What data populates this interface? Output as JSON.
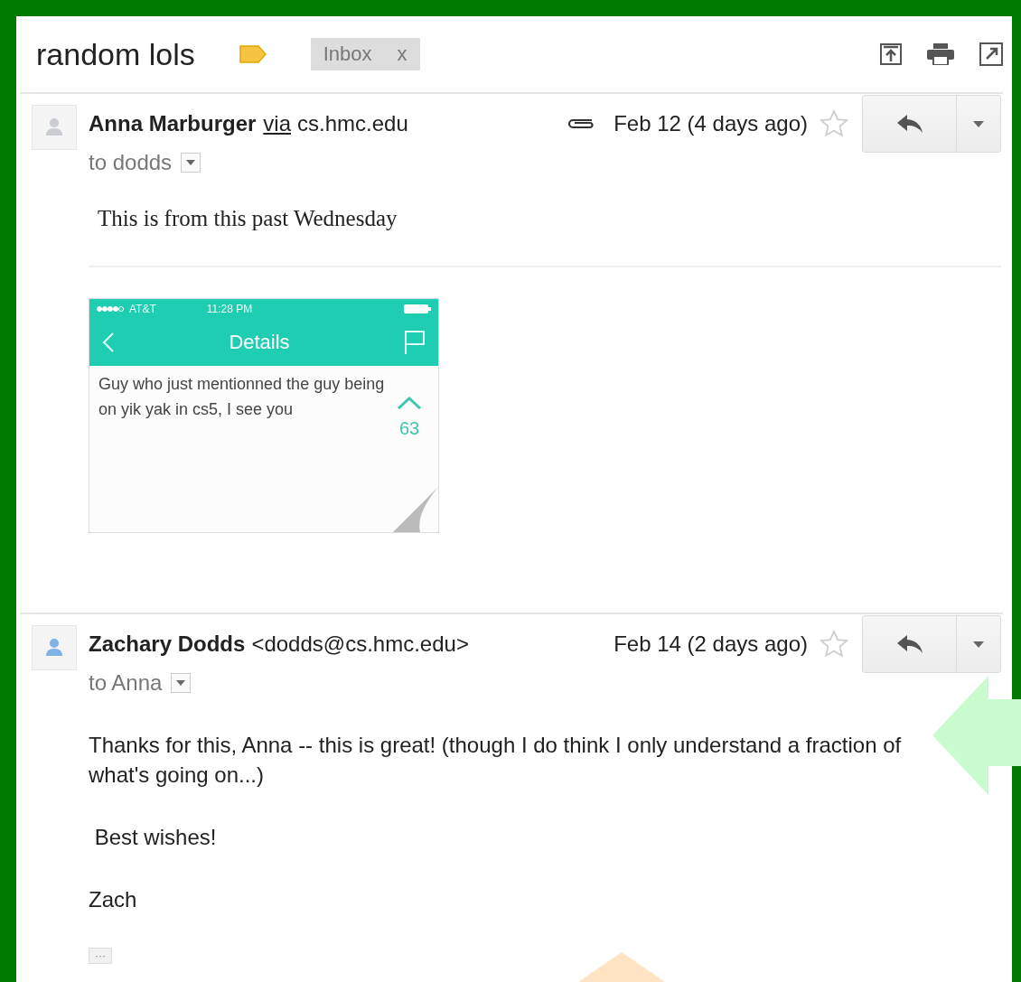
{
  "thread": {
    "subject": "random lols",
    "label": {
      "name": "Inbox",
      "remove": "x"
    }
  },
  "messages": [
    {
      "kind": "original",
      "avatar": {
        "color": "#c9ccd1"
      },
      "sender": "Anna Marburger",
      "via": "via",
      "address": "cs.hmc.edu",
      "has_attachment": true,
      "date": "Feb 12 (4 days ago)",
      "starred": false,
      "recipient": "to dodds",
      "body": [
        "This is from this past Wednesday"
      ],
      "attachment": {
        "status_bar": {
          "carrier": "AT&T",
          "time": "11:28 PM"
        },
        "title": "Details",
        "post": "Guy who just mentionned the guy being on yik yak in cs5, I see you",
        "votes": "63"
      }
    },
    {
      "kind": "reply",
      "avatar": {
        "color": "#7fb2e5"
      },
      "sender": "Zachary Dodds",
      "address": "<dodds@cs.hmc.edu>",
      "has_attachment": false,
      "date": "Feb 14 (2 days ago)",
      "starred": false,
      "recipient": "to Anna",
      "body": [
        "Thanks for this, Anna -- this is great! (though I do think I only understand a fraction of what's going on...)",
        " Best wishes!",
        "Zach"
      ],
      "trimmed_button": "···"
    }
  ]
}
